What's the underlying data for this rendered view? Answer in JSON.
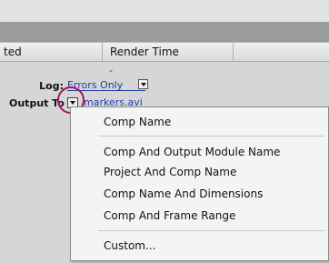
{
  "columns": {
    "started": "ted",
    "render_time": "Render Time"
  },
  "row": {
    "render_time_value": "-"
  },
  "log": {
    "label": "Log:",
    "value": "Errors Only"
  },
  "output": {
    "label": "Output To:",
    "file": "markers.avi"
  },
  "menu": {
    "items": [
      "Comp Name",
      "Comp And Output Module Name",
      "Project And Comp Name",
      "Comp Name And Dimensions",
      "Comp And Frame Range",
      "Custom..."
    ]
  },
  "colors": {
    "annotation_circle": "#a4145d",
    "link_text": "#1e3fa8"
  }
}
